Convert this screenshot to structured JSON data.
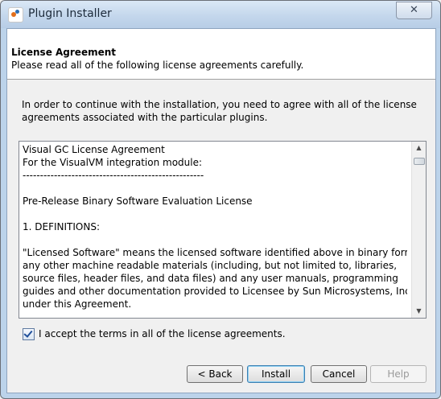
{
  "window": {
    "title": "Plugin Installer",
    "close_glyph": "✕"
  },
  "header": {
    "title": "License Agreement",
    "subtitle": "Please read all of the following license agreements carefully."
  },
  "intro": "In order to continue with the installation, you need to agree with all of the license agreements associated with the particular plugins.",
  "license_lines": [
    "Visual GC License Agreement",
    "For the VisualVM integration module:",
    "----------------------------------------------------",
    "",
    "Pre-Release Binary Software Evaluation License",
    "",
    "1. DEFINITIONS:",
    "",
    "\"Licensed Software\" means the licensed software identified above in binary form,",
    "any other machine readable materials (including, but not limited to, libraries,",
    "source files, header files, and data files) and any user manuals, programming",
    "guides and other documentation provided to Licensee by Sun Microsystems, Inc.",
    "under this Agreement."
  ],
  "scrollbar": {
    "up": "▲",
    "down": "▼"
  },
  "accept": {
    "label": "I accept the terms in all of the license agreements.",
    "checked": true
  },
  "buttons": {
    "back": "< Back",
    "install": "Install",
    "cancel": "Cancel",
    "help": "Help"
  }
}
